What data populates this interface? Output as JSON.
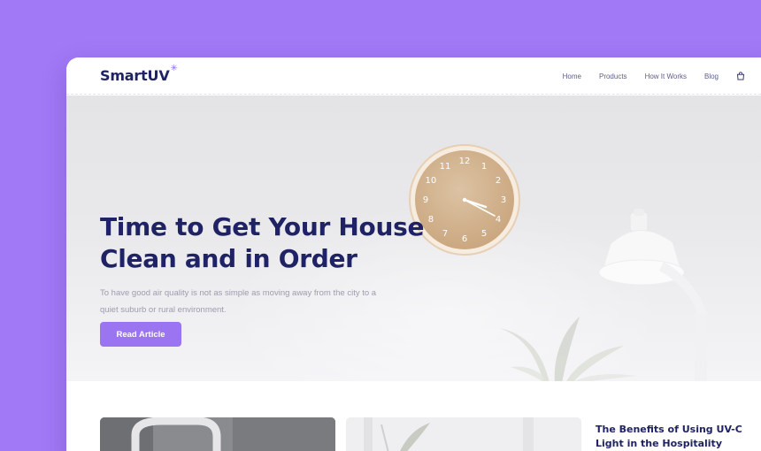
{
  "brand": {
    "name": "SmartUV",
    "accent": "#9b74f2",
    "navy": "#1f2264",
    "background": "#a178f6"
  },
  "nav": {
    "links": [
      "Home",
      "Products",
      "How It Works",
      "Blog"
    ],
    "cart_icon": "shopping-bag-icon"
  },
  "hero": {
    "title_lines": [
      "Time to Get Your House",
      "Clean and in Order"
    ],
    "subtitle_lines": [
      "To have good air quality is not as simple as moving away from the city to a",
      "quiet suburb or rural environment."
    ],
    "button_label": "Read Article",
    "clock_numbers": [
      "12",
      "1",
      "2",
      "3",
      "4",
      "5",
      "6",
      "7",
      "8",
      "9",
      "10",
      "11"
    ]
  },
  "articles": {
    "side_title_lines": [
      "The Benefits of Using UV-C",
      "Light in the Hospitality"
    ]
  }
}
